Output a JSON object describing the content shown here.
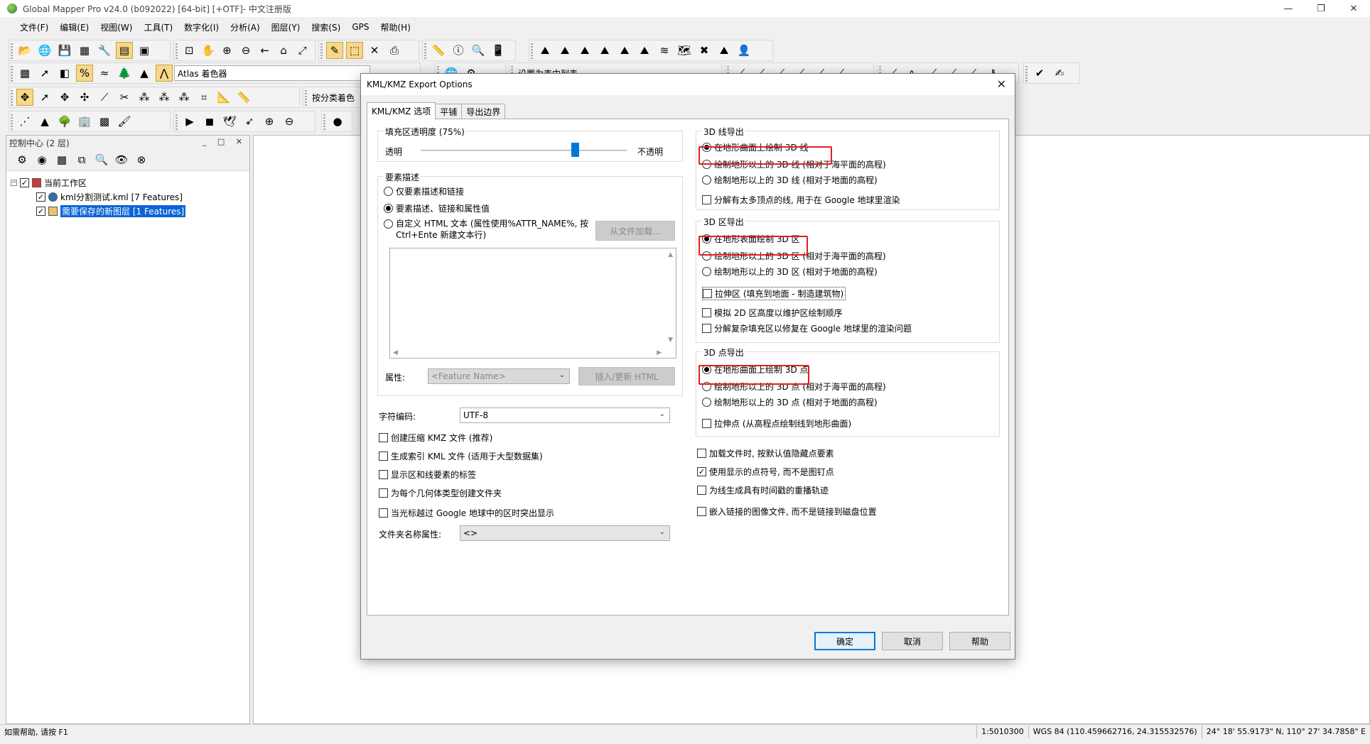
{
  "window": {
    "title": "Global Mapper Pro v24.0 (b092022) [64-bit] [+OTF]- 中文注册版",
    "minimize": "—",
    "maximize": "❐",
    "close": "✕"
  },
  "menu": [
    "文件(F)",
    "编辑(E)",
    "视图(W)",
    "工具(T)",
    "数字化(I)",
    "分析(A)",
    "图层(Y)",
    "搜索(S)",
    "GPS",
    "帮助(H)"
  ],
  "toolbar": {
    "shader_label": "Atlas 着色器",
    "classify_label": "按分类着色",
    "view_list_label": "设置为表中列表"
  },
  "control_center": {
    "title": "控制中心 (2 层)",
    "workspace_label": "当前工作区",
    "layers": [
      {
        "name": "kml分割测试.kml [7 Features]",
        "checked": true,
        "selected": false
      },
      {
        "name": "需要保存的新图层 [1 Features]",
        "checked": true,
        "selected": true
      }
    ]
  },
  "status": {
    "help": "如需帮助, 请按 F1",
    "scale": "1:5010300",
    "projection": "WGS 84 (110.459662716, 24.315532576)",
    "coords": "24° 18' 55.9173\" N, 110° 27' 34.7858\" E"
  },
  "dialog": {
    "title": "KML/KMZ Export Options",
    "tabs": [
      "KML/KMZ 选项",
      "平铺",
      "导出边界"
    ],
    "active_tab": 0,
    "fill": {
      "label": "填充区透明度 (75%)",
      "left": "透明",
      "right": "不透明",
      "value_percent": 75
    },
    "feature_desc": {
      "label": "要素描述",
      "opt1": "仅要素描述和链接",
      "opt2": "要素描述、链接和属性值",
      "opt3_line1": "自定义 HTML 文本 (属性使用%ATTR_NAME%, 按",
      "opt3_line2": "Ctrl+Ente 新建文本行)",
      "selected": 2,
      "load_button": "从文件加载...",
      "attr_label": "属性:",
      "attr_value": "<Feature Name>",
      "insert_button": "插入/更新 HTML"
    },
    "encoding_label": "字符编码:",
    "encoding_value": "UTF-8",
    "left_checks": [
      {
        "label": "创建压缩 KMZ 文件 (推荐)",
        "checked": false
      },
      {
        "label": "生成索引 KML 文件 (适用于大型数据集)",
        "checked": false
      },
      {
        "label": "显示区和线要素的标签",
        "checked": false
      },
      {
        "label": "为每个几何体类型创建文件夹",
        "checked": false
      },
      {
        "label": "当光标越过 Google 地球中的区时突出显示",
        "checked": false
      }
    ],
    "folder_attr_label": "文件夹名称属性:",
    "folder_attr_value": "<>",
    "line3d": {
      "label": "3D 线导出",
      "opt1": "在地形曲面上绘制 3D 线",
      "opt2": "绘制地形以上的 3D 线 (相对于海平面的高程)",
      "opt3": "绘制地形以上的 3D 线 (相对于地面的高程)",
      "check": "分解有太多顶点的线, 用于在 Google 地球里渲染"
    },
    "area3d": {
      "label": "3D 区导出",
      "opt1": "在地形表面绘制 3D 区",
      "opt2": "绘制地形以上的 3D 区 (相对于海平面的高程)",
      "opt3": "绘制地形以上的 3D 区 (相对于地面的高程)",
      "check1": "拉伸区 (填充到地面 - 制造建筑物)",
      "check2": "模拟 2D 区高度以维护区绘制顺序",
      "check3": "分解复杂填充区以修复在 Google 地球里的渲染问题"
    },
    "point3d": {
      "label": "3D 点导出",
      "opt1": "在地形曲面上绘制 3D 点",
      "opt2": "绘制地形以上的 3D 点 (相对于海平面的高程)",
      "opt3": "绘制地形以上的 3D 点 (相对于地面的高程)",
      "check": "拉伸点 (从高程点绘制线到地形曲面)"
    },
    "right_checks": [
      {
        "label": "加载文件时, 按默认值隐藏点要素",
        "checked": false
      },
      {
        "label": "使用显示的点符号, 而不是图钉点",
        "checked": true
      },
      {
        "label": "为线生成具有时间戳的重播轨迹",
        "checked": false
      },
      {
        "label": "嵌入链接的图像文件, 而不是链接到磁盘位置",
        "checked": false
      }
    ],
    "ok": "确定",
    "cancel": "取消",
    "help": "帮助"
  }
}
